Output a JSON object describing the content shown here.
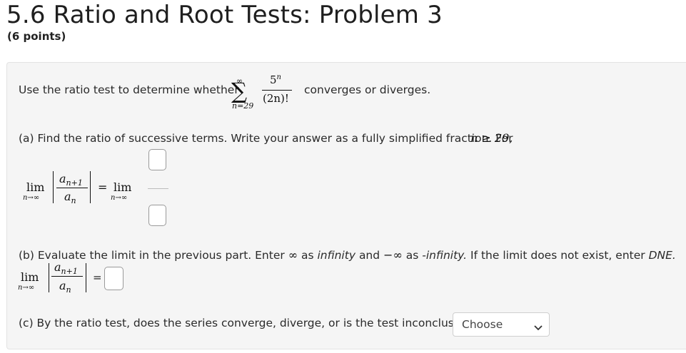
{
  "header": {
    "title": "5.6 Ratio and Root Tests: Problem 3",
    "points": "(6 points)"
  },
  "intro": {
    "before": "Use the ratio test to determine whether",
    "after": "converges or diverges.",
    "sum_upper": "∞",
    "sum_lower": "n=29",
    "numerator": "5",
    "numerator_exp": "n",
    "denominator": "(2n)!"
  },
  "part_a": {
    "text": "(a) Find the ratio of successive terms. Write your answer as a fully simplified fraction. For",
    "condition": "n ≥ 29,",
    "lim": "lim",
    "lim_sub": "n→∞",
    "a_next": "a",
    "a_next_sub": "n+1",
    "a_curr": "a",
    "a_curr_sub": "n",
    "equals": "="
  },
  "part_b": {
    "text_1": "(b) Evaluate the limit in the previous part. Enter",
    "inf_symbol": "∞",
    "text_2": "as",
    "kw_infinity": "infinity",
    "text_3": "and",
    "neg_inf_symbol": "−∞",
    "text_4": "as",
    "kw_neg_infinity": "-infinity.",
    "text_5": "If the limit does not exist, enter",
    "kw_dne": "DNE."
  },
  "part_c": {
    "text": "(c) By the ratio test, does the series converge, diverge, or is the test inconclusive?",
    "select_value": "Choose"
  }
}
